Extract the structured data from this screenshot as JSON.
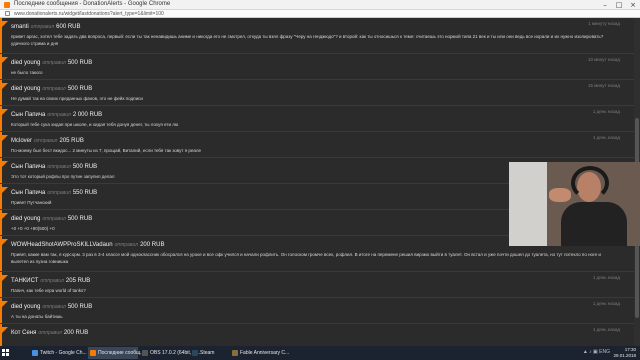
{
  "window": {
    "title": "Последние сообщения - DonationAlerts - Google Chrome",
    "url": "www.donationalerts.ru/widget/lastdonations?alert_type=1&limit=100"
  },
  "colors": {
    "accent": "#f57d07",
    "background": "#2b2b2b",
    "taskbar": "#1b2330"
  },
  "messages": [
    {
      "name": "smanti",
      "action": "отправил",
      "amount": "600 RUB",
      "time": "1 минуту назад",
      "text": "привет аргас, хотел тебе задать два вопроса, первый: если ты так ненавидишь аниме и никогда его не смотрел, откуда ты взял фразу \"Черу на генджюдо\"? и второй: как ты относишься к теме: считаешь это нормой типа 21 век и ты или они ведь все иорали и их нужно изолировать? удачного стрима и дня"
    },
    {
      "name": "died young",
      "action": "отправил",
      "amount": "500 RUB",
      "time": "10 минут назад",
      "text": "не было такого"
    },
    {
      "name": "died young",
      "action": "отправил",
      "amount": "500 RUB",
      "time": "15 минут назад",
      "text": "Не думай так на своих преданных фанов, это не фейк подписи"
    },
    {
      "name": "Сын Папича",
      "action": "отправил",
      "amount": "2 000 RUB",
      "time": "1 день назад",
      "text": "Который тебе сука хидая при школе, и хидая тебя донуя денег, ты лохуя ети лю"
    },
    {
      "name": "Mclover",
      "action": "отправил",
      "amount": "205 RUB",
      "time": "1 день назад",
      "text": "По-моему был бест вкидос... 2 минуты из 7, прощай, Виталий, если тебя так зовут я реале"
    },
    {
      "name": "Сын Папича",
      "action": "отправил",
      "amount": "500 RUB",
      "time": "1 день назад",
      "text": "Это тот который рофлы про путин запулил делал"
    },
    {
      "name": "Сын Папича",
      "action": "отправил",
      "amount": "550 RUB",
      "time": "1 день назад",
      "text": "Привет Путчанский"
    },
    {
      "name": "died young",
      "action": "отправил",
      "amount": "500 RUB",
      "time": "1 день назад",
      "text": "+0 +0 +0 +90(500) +0"
    },
    {
      "name": "WOWHeadShotAWPProSKILLVadaun",
      "action": "отправил",
      "amount": "200 RUB",
      "time": "1 день назад",
      "text": "Привет, какие вам так, я курсорм. 3 раз в 3-4 классе мой однокласcник обосрался на уроке и все офк учился и начали рофлить. Он голоском громче всех, рофлил. В итоге на перемене решил вирзмо выйти в туалет. Он встал и уже почти дошел до туалета, но тут потекло по ноге и вылетел из пузна говнишка"
    },
    {
      "name": "ТАНКИСТ",
      "action": "отправил",
      "amount": "205 RUB",
      "time": "1 день назад",
      "text": "Папич, как тебе игра world of tanks?"
    },
    {
      "name": "died young",
      "action": "отправил",
      "amount": "500 RUB",
      "time": "1 день назад",
      "text": "А ты на донаты байтишь"
    },
    {
      "name": "Кот Сеня",
      "action": "отправил",
      "amount": "200 RUB",
      "time": "1 день назад",
      "text": ""
    }
  ],
  "taskbar": {
    "items": [
      {
        "label": "Twitch - Google Ch...",
        "color": "#4a90e2"
      },
      {
        "label": "Последние сообщ...",
        "color": "#f57d07"
      },
      {
        "label": "OBS 17.0.2 (64bit, w...",
        "color": "#555555"
      },
      {
        "label": "Steam",
        "color": "#2a475e"
      },
      {
        "label": "Fable Anniversary C...",
        "color": "#8a6d3b"
      }
    ],
    "tray_icons": "▲ ♪ ▣ ENG",
    "time": "17:30",
    "date": "29.01.2018"
  }
}
